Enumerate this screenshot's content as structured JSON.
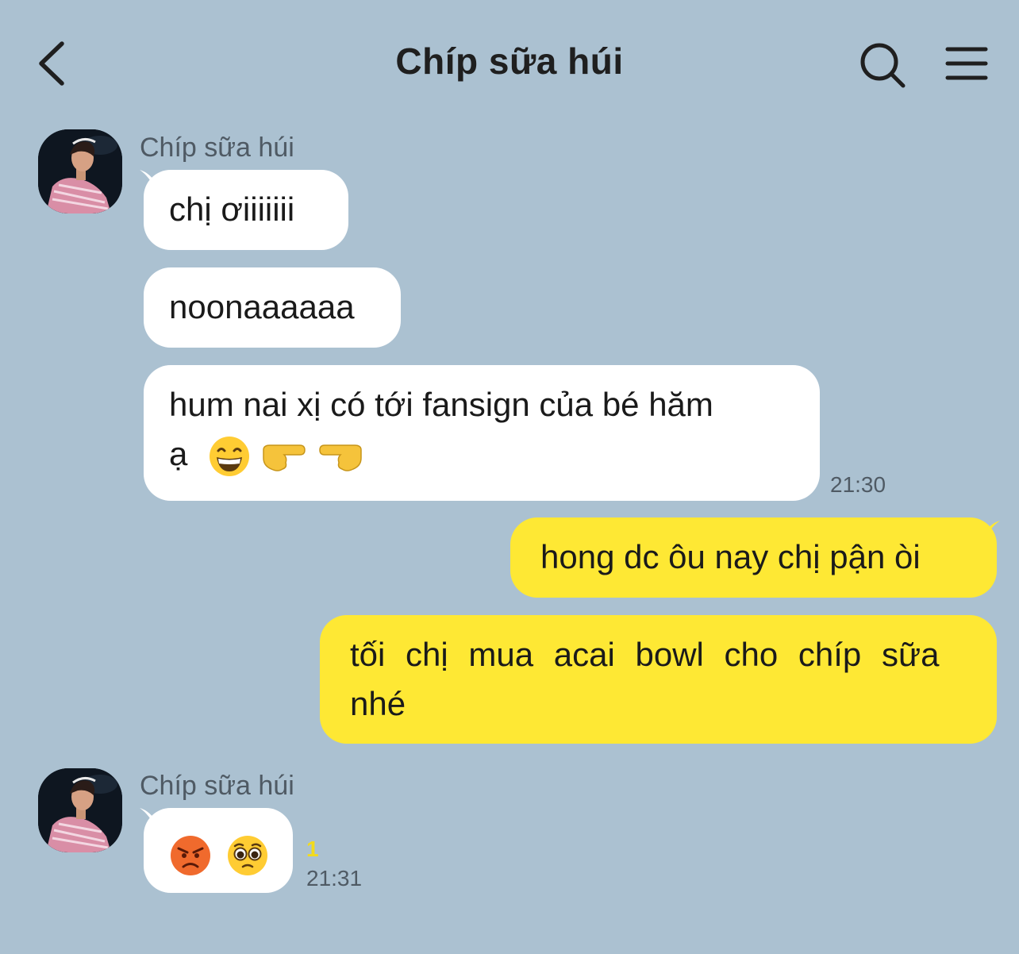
{
  "header": {
    "title": "Chíp sữa húi"
  },
  "messages": {
    "group1": {
      "sender": "Chíp sữa húi",
      "m1": "chị ơiiiiiii",
      "m2": "noonaaaaaa",
      "m3_line1": "hum nai xị có tới fansign của bé hăm",
      "m3_line2": "ạ",
      "time": "21:30"
    },
    "out1": "hong dc ôu nay chị pận òi",
    "out2_line1": "tối chị mua acai bowl cho chíp sữa",
    "out2_line2": "nhé",
    "group2": {
      "sender": "Chíp sữa húi",
      "unread": "1",
      "time": "21:31"
    }
  },
  "icons": {
    "back": "chevron-left-icon",
    "search": "search-icon",
    "menu": "hamburger-menu-icon",
    "emoji_grin": "grinning-face-emoji",
    "emoji_point_right": "pointing-right-emoji",
    "emoji_point_left": "pointing-left-emoji",
    "emoji_angry": "angry-face-emoji",
    "emoji_pleading": "pleading-face-emoji"
  },
  "colors": {
    "background": "#abc1d1",
    "incoming_bubble": "#ffffff",
    "outgoing_bubble": "#fee834",
    "unread_count": "#f3db1c"
  }
}
